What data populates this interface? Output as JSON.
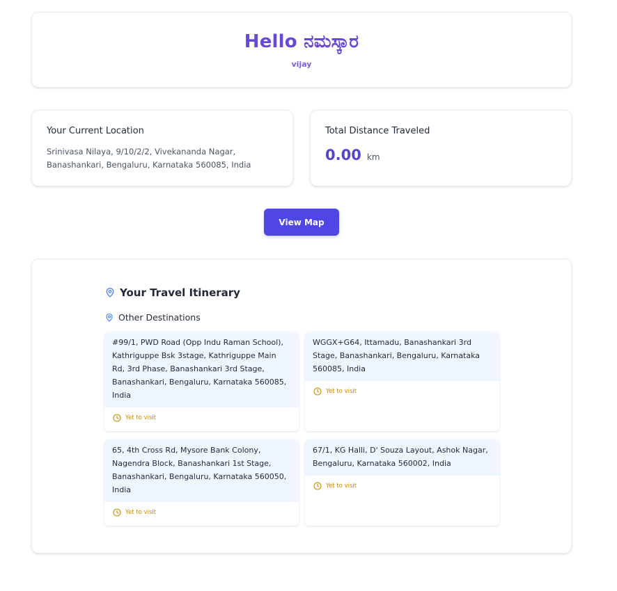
{
  "greeting": {
    "title": "Hello ನಮಸ್ಕಾರ",
    "user": "vijay"
  },
  "current_location": {
    "label": "Your Current Location",
    "address": "Srinivasa Nilaya, 9/10/2/2, Vivekananda Nagar, Banashankari, Bengaluru, Karnataka 560085, India"
  },
  "distance": {
    "label": "Total Distance Traveled",
    "value": "0.00",
    "unit": "km"
  },
  "actions": {
    "view_map_label": "View Map"
  },
  "itinerary": {
    "title": "Your Travel Itinerary",
    "subtitle": "Other Destinations",
    "destinations": [
      {
        "address": "#99/1, PWD Road (Opp Indu Raman School), Kathriguppe Bsk 3stage, Kathriguppe Main Rd, 3rd Phase, Banashankari 3rd Stage, Banashankari, Bengaluru, Karnataka 560085, India",
        "status": "Yet to visit"
      },
      {
        "address": "WGGX+G64, Ittamadu, Banashankari 3rd Stage, Banashankari, Bengaluru, Karnataka 560085, India",
        "status": "Yet to visit"
      },
      {
        "address": "65, 4th Cross Rd, Mysore Bank Colony, Nagendra Block, Banashankari 1st Stage, Banashankari, Bengaluru, Karnataka 560050, India",
        "status": "Yet to visit"
      },
      {
        "address": "67/1, KG Halli, D' Souza Layout, Ashok Nagar, Bengaluru, Karnataka 560002, India",
        "status": "Yet to visit"
      }
    ]
  },
  "colors": {
    "brand_purple": "#6a48d7",
    "button_indigo": "#4f46e5",
    "pin_blue": "#3b82f6",
    "status_amber": "#ca8a04",
    "address_bg": "#eff6ff"
  },
  "icons": {
    "itinerary": "map-pin-icon",
    "destinations": "map-pin-icon",
    "status": "clock-icon"
  }
}
